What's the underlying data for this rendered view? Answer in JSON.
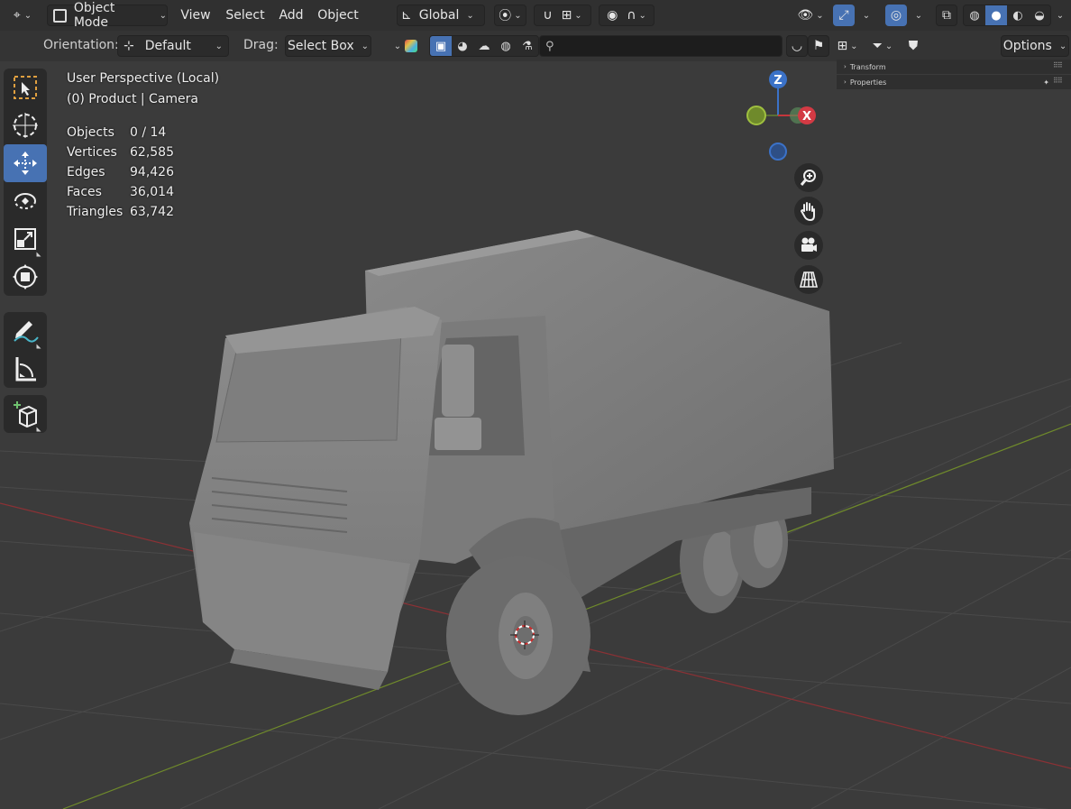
{
  "header": {
    "mode_label": "Object Mode",
    "menus": [
      "View",
      "Select",
      "Add",
      "Object"
    ],
    "transform_orientation": "Global",
    "options_label": "Options"
  },
  "tool_settings": {
    "orientation_label": "Orientation:",
    "orientation_value": "Default",
    "drag_label": "Drag:",
    "drag_value": "Select Box",
    "search_placeholder": ""
  },
  "viewport": {
    "view_name": "User Perspective (Local)",
    "collection_line": "(0) Product | Camera",
    "stats": [
      {
        "label": "Objects",
        "value": "0 / 14"
      },
      {
        "label": "Vertices",
        "value": "62,585"
      },
      {
        "label": "Edges",
        "value": "94,426"
      },
      {
        "label": "Faces",
        "value": "36,014"
      },
      {
        "label": "Triangles",
        "value": "63,742"
      }
    ],
    "gizmo": {
      "z_label": "Z",
      "x_label": "X"
    }
  },
  "sidebar": {
    "panels": [
      {
        "label": "Transform"
      },
      {
        "label": "Properties"
      }
    ]
  },
  "toolbar": {
    "tools": [
      "select-box",
      "cursor",
      "move",
      "rotate",
      "scale",
      "transform",
      "annotate",
      "measure",
      "add-cube"
    ],
    "active_tool": "move"
  },
  "colors": {
    "accent": "#4772b3",
    "axis_x": "#c5363c",
    "axis_y": "#7aa02c",
    "axis_z": "#3b72c8"
  }
}
